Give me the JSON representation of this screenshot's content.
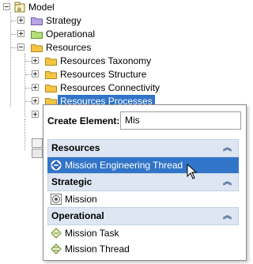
{
  "tree": {
    "root": {
      "label": "Model"
    },
    "items": [
      {
        "label": "Strategy"
      },
      {
        "label": "Operational"
      },
      {
        "label": "Resources"
      }
    ],
    "children": [
      {
        "label": "Resources Taxonomy"
      },
      {
        "label": "Resources Structure"
      },
      {
        "label": "Resources Connectivity"
      },
      {
        "label": "Resources Processes"
      }
    ]
  },
  "popup": {
    "create_label": "Create Element:",
    "search_value": "Mis",
    "groups": [
      {
        "title": "Resources",
        "items": [
          {
            "label": "Mission Engineering Thread",
            "icon": "mission-engineering-thread-icon"
          }
        ]
      },
      {
        "title": "Strategic",
        "items": [
          {
            "label": "Mission",
            "icon": "mission-icon"
          }
        ]
      },
      {
        "title": "Operational",
        "items": [
          {
            "label": "Mission Task",
            "icon": "mission-task-icon"
          },
          {
            "label": "Mission Thread",
            "icon": "mission-thread-icon"
          }
        ]
      }
    ],
    "collapse_glyph": "︽"
  },
  "colors": {
    "selection": "#3174c8",
    "group_header": "#dde6f2",
    "folder_yellow": "#f5c542",
    "folder_purple": "#b9a6e6",
    "folder_green": "#b7e07a"
  }
}
